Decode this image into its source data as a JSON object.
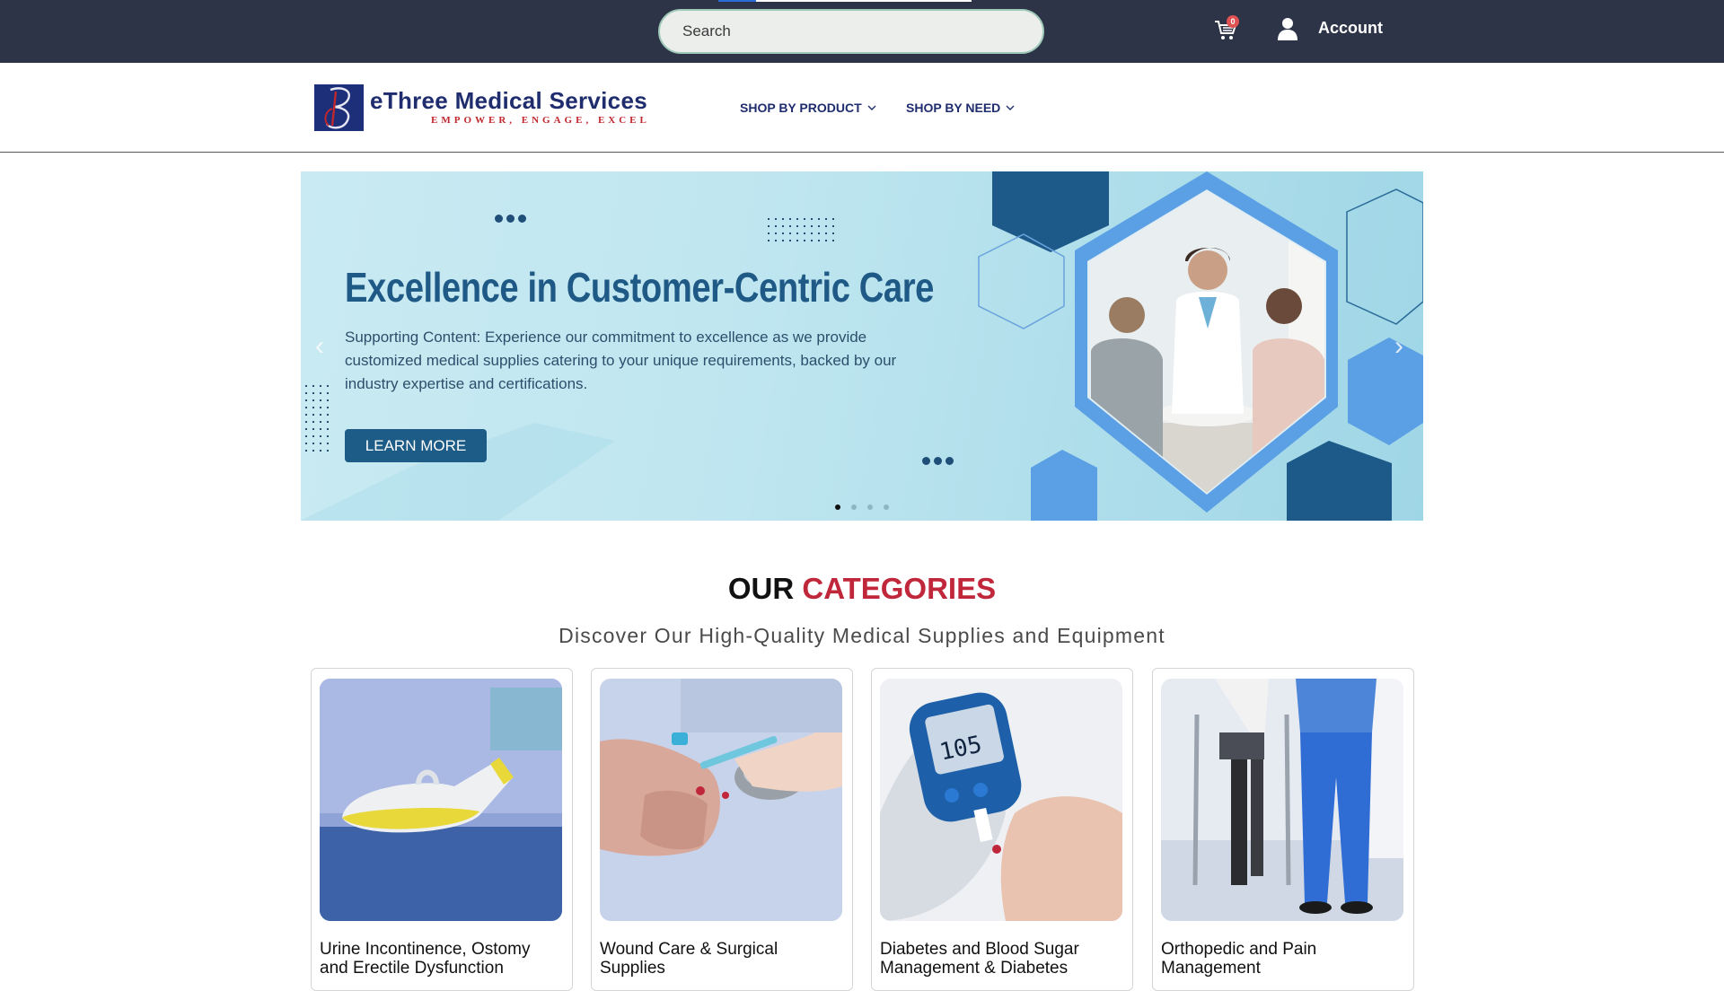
{
  "topbar": {
    "search_placeholder": "Search",
    "cart_count": "0",
    "account_label": "Account"
  },
  "header": {
    "logo_name": "eThree Medical Services",
    "logo_tagline": "EMPOWER, ENGAGE, EXCEL",
    "nav": [
      {
        "label": "SHOP BY PRODUCT"
      },
      {
        "label": "SHOP BY NEED"
      }
    ]
  },
  "hero": {
    "title": "Excellence in Customer-Centric Care",
    "text": "Supporting Content: Experience our commitment to excellence as we provide customized medical supplies catering to your unique requirements, backed by our industry expertise and certifications.",
    "button_label": "LEARN MORE",
    "slide_count": 4,
    "active_slide": 1
  },
  "categories": {
    "heading_prefix": "OUR",
    "heading_accent": "CATEGORIES",
    "subtitle": "Discover Our High-Quality Medical Supplies and Equipment",
    "items": [
      {
        "title": "Urine Incontinence, Ostomy and Erectile Dysfunction"
      },
      {
        "title": "Wound Care & Surgical Supplies"
      },
      {
        "title": "Diabetes and Blood Sugar Management & Diabetes"
      },
      {
        "title": "Orthopedic and Pain Management"
      }
    ]
  },
  "colors": {
    "topbar_bg": "#2d3448",
    "brand_navy": "#1f2d6e",
    "accent_red": "#c0273b",
    "hero_button": "#1d5c86"
  }
}
